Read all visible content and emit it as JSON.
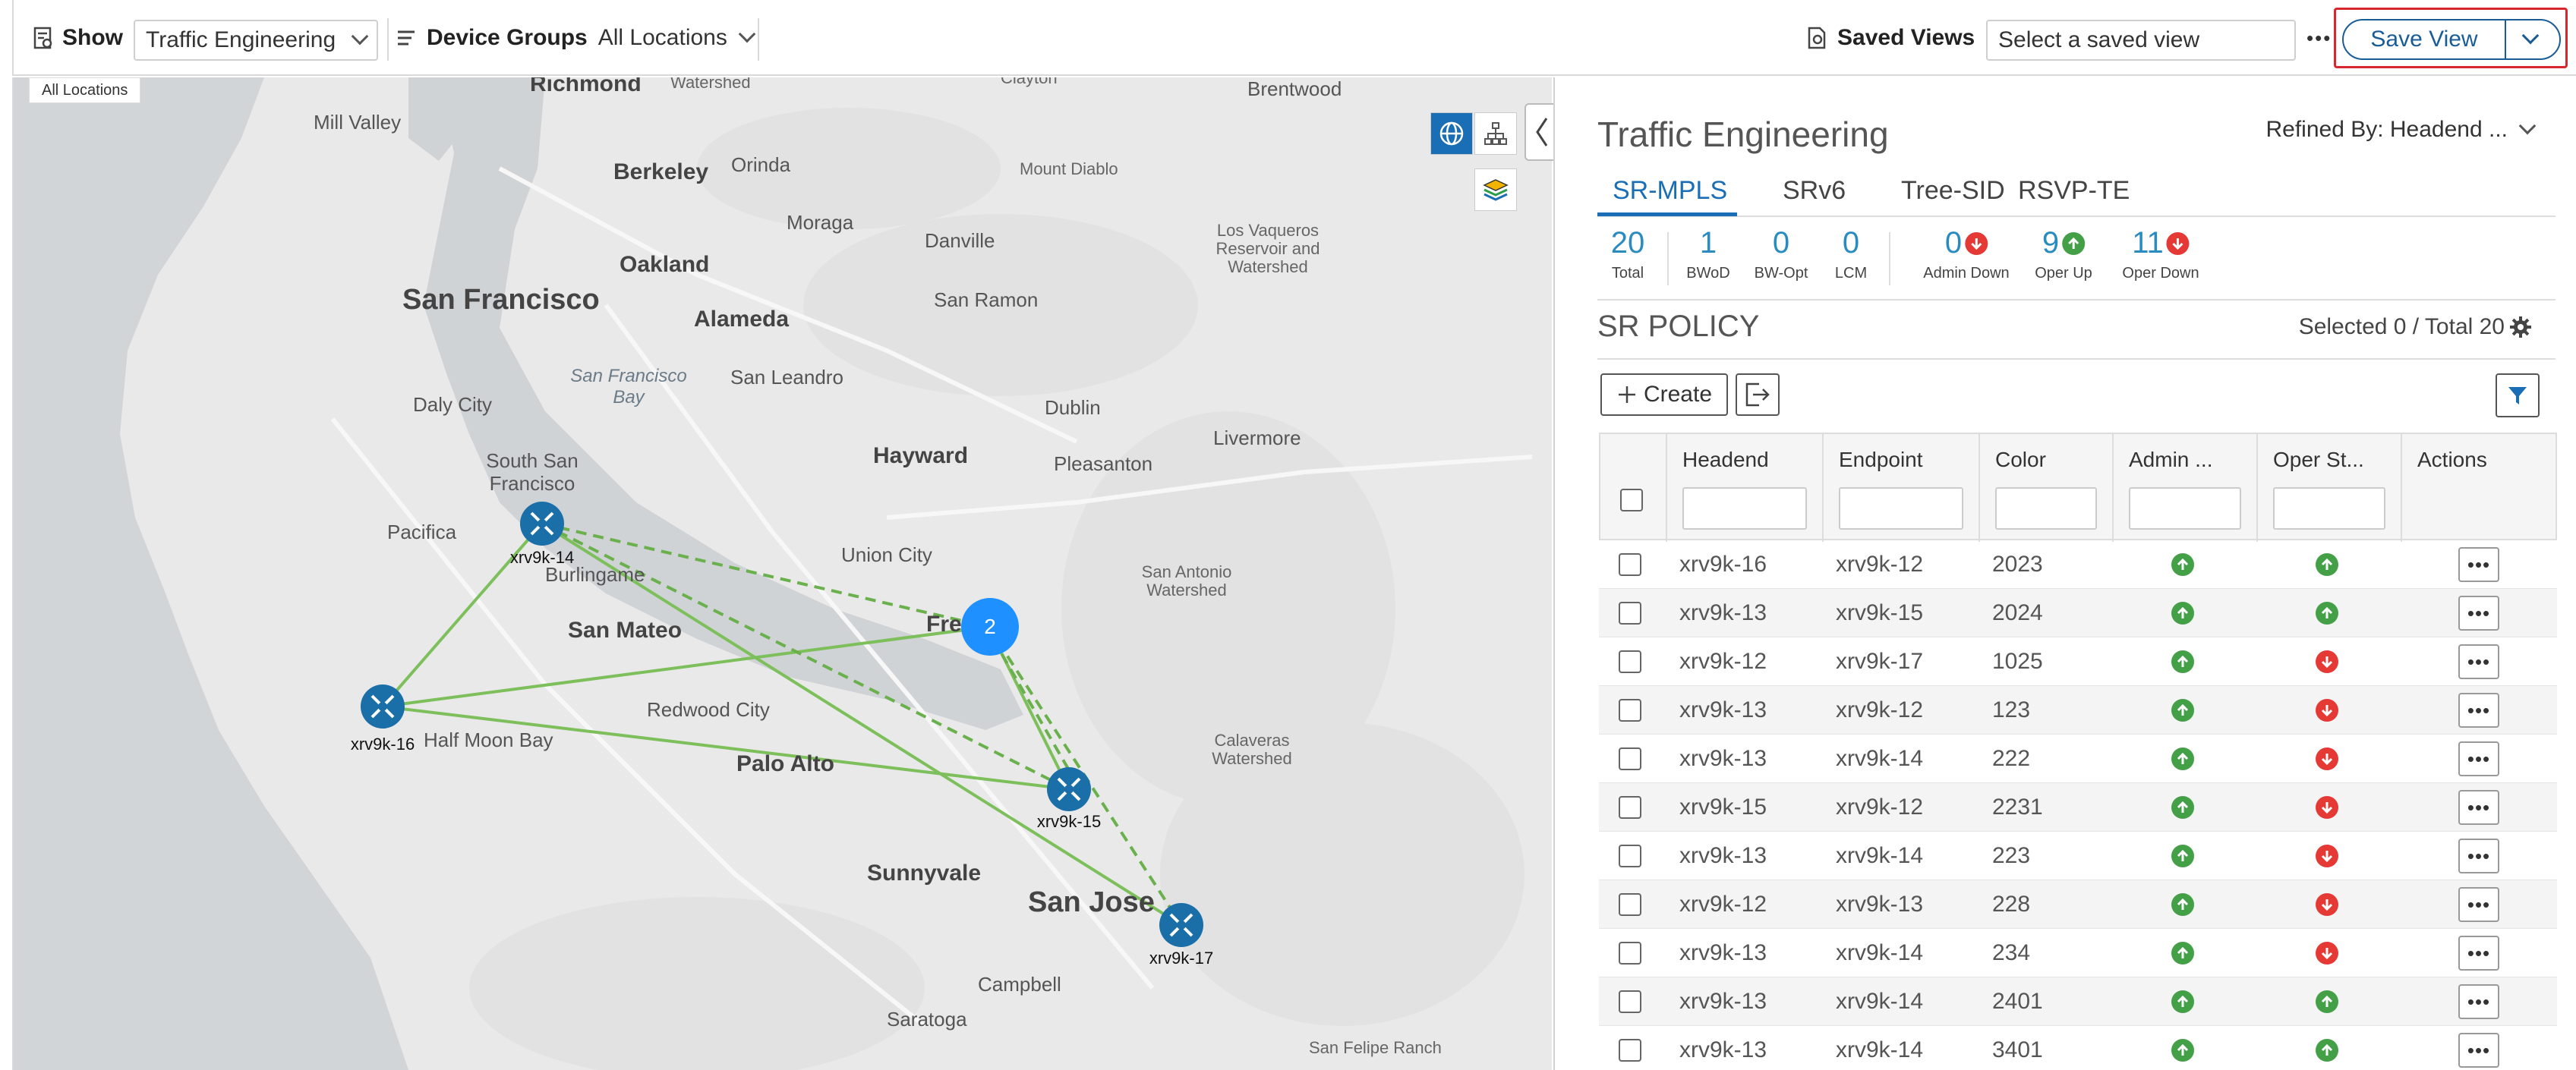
{
  "colors": {
    "accent": "#1a6eb5",
    "up": "#43a047",
    "down": "#e53935",
    "link": "#7cbf5b",
    "save_border": "#d8282f"
  },
  "toolbar": {
    "show_label": "Show",
    "show_value": "Traffic Engineering",
    "device_groups_label": "Device Groups",
    "device_groups_value": "All Locations",
    "saved_views_label": "Saved Views",
    "saved_view_placeholder": "Select a saved view",
    "more": "•••",
    "save_view": "Save View"
  },
  "map": {
    "all_locations": "All Locations",
    "cluster_count": "2",
    "nodes": [
      {
        "id": "xrv9k-14",
        "label": "xrv9k-14"
      },
      {
        "id": "xrv9k-16",
        "label": "xrv9k-16"
      },
      {
        "id": "xrv9k-15",
        "label": "xrv9k-15"
      },
      {
        "id": "xrv9k-17",
        "label": "xrv9k-17"
      }
    ],
    "places": {
      "richmond": "Richmond",
      "brentwood": "Brentwood",
      "mill_valley": "Mill Valley",
      "berkeley": "Berkeley",
      "orinda": "Orinda",
      "mount_diablo": "Mount Diablo",
      "watershed": "Watershed",
      "clayton": "Clayton",
      "oakland": "Oakland",
      "moraga": "Moraga",
      "danville": "Danville",
      "los_vaqueros": "Los Vaqueros Reservoir and Watershed",
      "san_francisco": "San Francisco",
      "alameda": "Alameda",
      "san_ramon": "San Ramon",
      "daly_city": "Daly City",
      "sf_bay": "San Francisco Bay",
      "san_leandro": "San Leandro",
      "dublin": "Dublin",
      "livermore": "Livermore",
      "hayward": "Hayward",
      "pleasanton": "Pleasanton",
      "south_sf": "South San Francisco",
      "pacifica": "Pacifica",
      "burlingame": "Burlingame",
      "union_city": "Union City",
      "san_antonio": "San Antonio Watershed",
      "san_mateo": "San Mateo",
      "fremont": "Fre",
      "redwood_city": "Redwood City",
      "half_moon_bay": "Half Moon Bay",
      "palo_alto": "Palo Alto",
      "calaveras": "Calaveras Watershed",
      "sunnyvale": "Sunnyvale",
      "san_jose": "San Jose",
      "campbell": "Campbell",
      "saratoga": "Saratoga",
      "san_felipe": "San Felipe Ranch"
    }
  },
  "panel": {
    "title": "Traffic Engineering",
    "refined_by": "Refined By: Headend ...",
    "tabs": [
      "SR-MPLS",
      "SRv6",
      "Tree-SID",
      "RSVP-TE"
    ],
    "stats": [
      {
        "value": "20",
        "label": "Total"
      },
      {
        "value": "1",
        "label": "BWoD"
      },
      {
        "value": "0",
        "label": "BW-Opt"
      },
      {
        "value": "0",
        "label": "LCM"
      },
      {
        "value": "0",
        "label": "Admin Down",
        "arrow": "down"
      },
      {
        "value": "9",
        "label": "Oper Up",
        "arrow": "up"
      },
      {
        "value": "11",
        "label": "Oper Down",
        "arrow": "down"
      }
    ],
    "section_title": "SR POLICY",
    "selected_total": "Selected 0 / Total 20",
    "create_label": "Create",
    "columns": [
      "Headend",
      "Endpoint",
      "Color",
      "Admin ...",
      "Oper St...",
      "Actions"
    ],
    "rows": [
      {
        "headend": "xrv9k-16",
        "endpoint": "xrv9k-12",
        "color": "2023",
        "admin": "up",
        "oper": "up"
      },
      {
        "headend": "xrv9k-13",
        "endpoint": "xrv9k-15",
        "color": "2024",
        "admin": "up",
        "oper": "up"
      },
      {
        "headend": "xrv9k-12",
        "endpoint": "xrv9k-17",
        "color": "1025",
        "admin": "up",
        "oper": "down"
      },
      {
        "headend": "xrv9k-13",
        "endpoint": "xrv9k-12",
        "color": "123",
        "admin": "up",
        "oper": "down"
      },
      {
        "headend": "xrv9k-13",
        "endpoint": "xrv9k-14",
        "color": "222",
        "admin": "up",
        "oper": "down"
      },
      {
        "headend": "xrv9k-15",
        "endpoint": "xrv9k-12",
        "color": "2231",
        "admin": "up",
        "oper": "down"
      },
      {
        "headend": "xrv9k-13",
        "endpoint": "xrv9k-14",
        "color": "223",
        "admin": "up",
        "oper": "down"
      },
      {
        "headend": "xrv9k-12",
        "endpoint": "xrv9k-13",
        "color": "228",
        "admin": "up",
        "oper": "down"
      },
      {
        "headend": "xrv9k-13",
        "endpoint": "xrv9k-14",
        "color": "234",
        "admin": "up",
        "oper": "down"
      },
      {
        "headend": "xrv9k-13",
        "endpoint": "xrv9k-14",
        "color": "2401",
        "admin": "up",
        "oper": "up"
      },
      {
        "headend": "xrv9k-13",
        "endpoint": "xrv9k-14",
        "color": "3401",
        "admin": "up",
        "oper": "up"
      }
    ],
    "row_action": "•••"
  }
}
